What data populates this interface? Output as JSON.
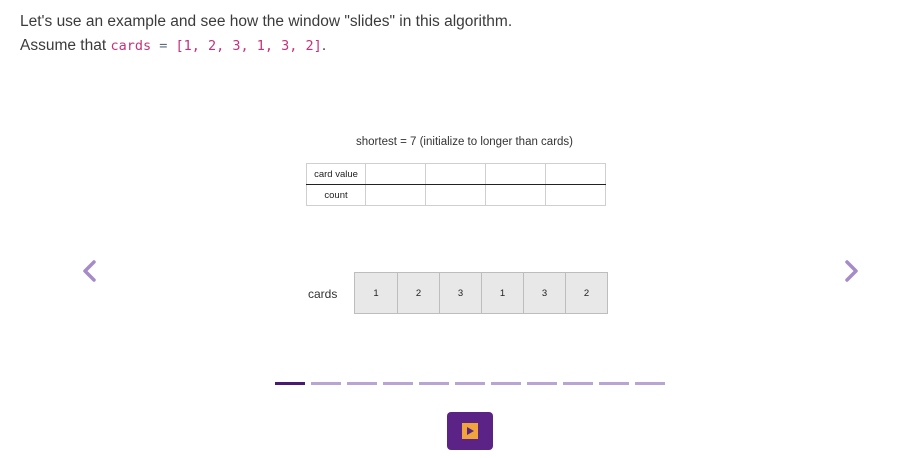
{
  "intro": {
    "line1": "Let's use an example and see how the window \"slides\" in this algorithm.",
    "line2_prefix": "Assume that ",
    "code_name": "cards",
    "code_op": " = ",
    "code_value": "[1, 2, 3, 1, 3, 2]",
    "line2_suffix": "."
  },
  "caption": "shortest = 7 (initialize to longer than cards)",
  "value_table": {
    "row1_label": "card value",
    "row2_label": "count"
  },
  "cards": {
    "label": "cards",
    "values": [
      "1",
      "2",
      "3",
      "1",
      "3",
      "2"
    ]
  },
  "nav": {
    "prev_icon": "chevron-left-icon",
    "next_icon": "chevron-right-icon",
    "total_steps": 11,
    "current_step": 1
  },
  "play_icon": "play-icon",
  "colors": {
    "accent": "#5b2386",
    "arrow": "#a58cc8",
    "progress_active": "#4a1a73",
    "progress_inactive": "#b8a5d4",
    "play_glyph": "#f0a43a",
    "code": "#c7307a"
  }
}
